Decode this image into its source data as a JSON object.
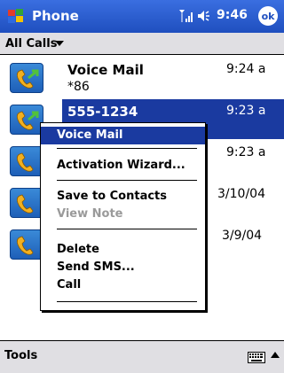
{
  "titlebar": {
    "title": "Phone",
    "time": "9:46",
    "ok_label": "ok",
    "icons": [
      "windows-start-icon",
      "signal-icon",
      "volume-icon"
    ]
  },
  "filter": {
    "label": "All Calls"
  },
  "calls": [
    {
      "name": "Voice Mail",
      "sub": "*86",
      "time": "9:24 a",
      "selected": false
    },
    {
      "name": "555-1234",
      "sub": "",
      "time": "9:23 a",
      "selected": true
    },
    {
      "name": "",
      "sub": "",
      "time": "9:23 a",
      "selected": false
    },
    {
      "name": "",
      "sub": "",
      "time": "3/10/04",
      "selected": false
    },
    {
      "name": "",
      "sub": "",
      "time": "3/9/04",
      "selected": false
    }
  ],
  "context_menu": {
    "items": [
      "Voice Mail",
      "Activation Wizard...",
      "Save to Contacts",
      "View Note",
      "Delete",
      "Send SMS...",
      "Call"
    ],
    "highlighted": "Voice Mail",
    "disabled": [
      "View Note"
    ]
  },
  "toolbar": {
    "tools_label": "Tools",
    "icons": [
      "keyboard-icon",
      "up-arrow-icon"
    ]
  },
  "colors": {
    "titlebar": "#2a5cd0",
    "selection": "#1a3aa0",
    "bar_gray": "#e0dfe3"
  }
}
